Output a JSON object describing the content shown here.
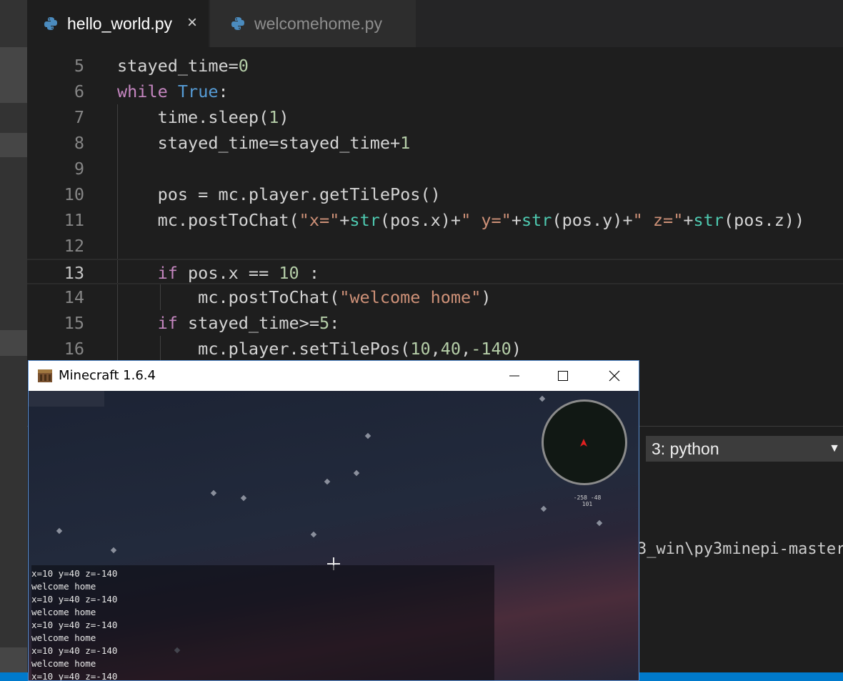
{
  "tabs": [
    {
      "label": "hello_world.py",
      "active": true,
      "close": "×"
    },
    {
      "label": "welcomehome.py",
      "active": false
    }
  ],
  "editor": {
    "lines": [
      {
        "num": "5",
        "tokens": [
          {
            "t": "stayed_time=",
            "c": "plain"
          },
          {
            "t": "0",
            "c": "num"
          }
        ]
      },
      {
        "num": "6",
        "tokens": [
          {
            "t": "while",
            "c": "kw"
          },
          {
            "t": " ",
            "c": "plain"
          },
          {
            "t": "True",
            "c": "const"
          },
          {
            "t": ":",
            "c": "plain"
          }
        ]
      },
      {
        "num": "7",
        "tokens": [
          {
            "t": "    time.sleep(",
            "c": "plain"
          },
          {
            "t": "1",
            "c": "num"
          },
          {
            "t": ")",
            "c": "plain"
          }
        ]
      },
      {
        "num": "8",
        "tokens": [
          {
            "t": "    stayed_time=stayed_time+",
            "c": "plain"
          },
          {
            "t": "1",
            "c": "num"
          }
        ]
      },
      {
        "num": "9",
        "tokens": []
      },
      {
        "num": "10",
        "tokens": [
          {
            "t": "    pos = mc.player.getTilePos()",
            "c": "plain"
          }
        ]
      },
      {
        "num": "11",
        "tokens": [
          {
            "t": "    mc.postToChat(",
            "c": "plain"
          },
          {
            "t": "\"x=\"",
            "c": "str"
          },
          {
            "t": "+",
            "c": "plain"
          },
          {
            "t": "str",
            "c": "bi"
          },
          {
            "t": "(pos.x)+",
            "c": "plain"
          },
          {
            "t": "\" y=\"",
            "c": "str"
          },
          {
            "t": "+",
            "c": "plain"
          },
          {
            "t": "str",
            "c": "bi"
          },
          {
            "t": "(pos.y)+",
            "c": "plain"
          },
          {
            "t": "\" z=\"",
            "c": "str"
          },
          {
            "t": "+",
            "c": "plain"
          },
          {
            "t": "str",
            "c": "bi"
          },
          {
            "t": "(pos.z))",
            "c": "plain"
          }
        ]
      },
      {
        "num": "12",
        "tokens": []
      },
      {
        "num": "13",
        "tokens": [
          {
            "t": "    ",
            "c": "plain"
          },
          {
            "t": "if",
            "c": "kw"
          },
          {
            "t": " pos.x == ",
            "c": "plain"
          },
          {
            "t": "10",
            "c": "num"
          },
          {
            "t": " :",
            "c": "plain"
          }
        ],
        "current": true
      },
      {
        "num": "14",
        "tokens": [
          {
            "t": "        mc.postToChat(",
            "c": "plain"
          },
          {
            "t": "\"welcome home\"",
            "c": "str"
          },
          {
            "t": ")",
            "c": "plain"
          }
        ]
      },
      {
        "num": "15",
        "tokens": [
          {
            "t": "    ",
            "c": "plain"
          },
          {
            "t": "if",
            "c": "kw"
          },
          {
            "t": " stayed_time>=",
            "c": "plain"
          },
          {
            "t": "5",
            "c": "num"
          },
          {
            "t": ":",
            "c": "plain"
          }
        ]
      },
      {
        "num": "16",
        "tokens": [
          {
            "t": "        mc.player.setTilePos(",
            "c": "plain"
          },
          {
            "t": "10",
            "c": "num"
          },
          {
            "t": ",",
            "c": "plain"
          },
          {
            "t": "40",
            "c": "num"
          },
          {
            "t": ",",
            "c": "plain"
          },
          {
            "t": "-140",
            "c": "num"
          },
          {
            "t": ")",
            "c": "plain"
          }
        ]
      }
    ]
  },
  "terminal": {
    "selector": "3: python",
    "arrow": "▼",
    "path_fragment": "3_win\\py3minepi-master"
  },
  "minecraft": {
    "title": "Minecraft 1.6.4",
    "chat": [
      "x=10 y=40 z=-140",
      "welcome home",
      "x=10 y=40 z=-140",
      "welcome home",
      "x=10 y=40 z=-140",
      "welcome home",
      "x=10 y=40 z=-140",
      "welcome home",
      "x=10 y=40 z=-140"
    ],
    "map_coords": "-258 -48\n101"
  },
  "colors": {
    "keyword": "#c586c0",
    "constant": "#569cd6",
    "number": "#b5cea8",
    "string": "#ce9178",
    "builtin": "#4ec9b0",
    "statusbar": "#007acc"
  }
}
